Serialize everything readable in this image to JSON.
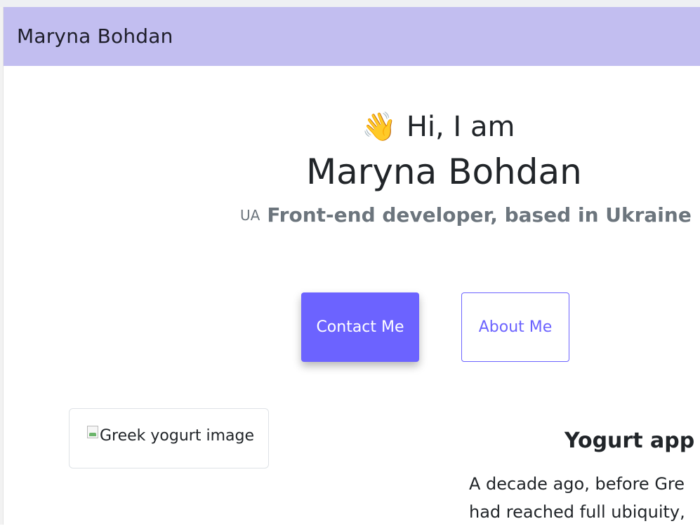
{
  "navbar": {
    "brand": "Maryna Bohdan"
  },
  "hero": {
    "wave_emoji": "👋",
    "greeting": "Hi, I am",
    "name": "Maryna Bohdan",
    "flag_text": "UA",
    "tagline": "Front-end developer, based in Ukraine"
  },
  "actions": {
    "contact_label": "Contact Me",
    "about_label": "About Me"
  },
  "project": {
    "image_alt": "Greek yogurt image",
    "title": "Yogurt app",
    "text_lines": [
      "A decade ago, before Gre",
      "had reached full ubiquity,"
    ]
  },
  "colors": {
    "navbar_bg": "#c2bef0",
    "accent": "#6c63ff"
  }
}
